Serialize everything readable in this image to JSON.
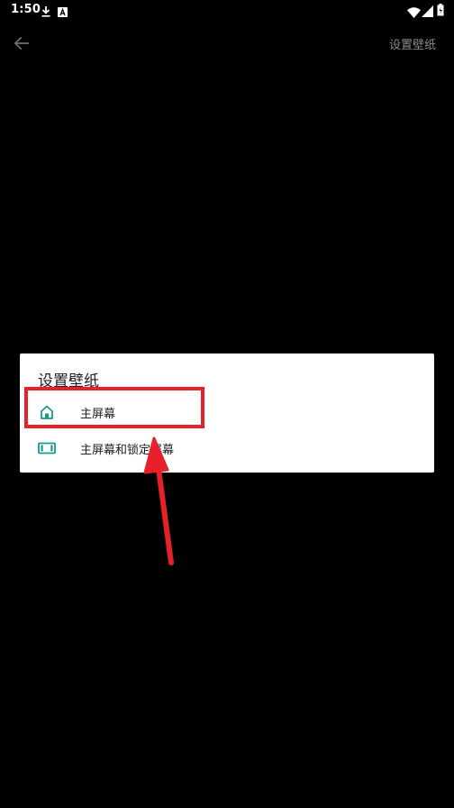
{
  "status_bar": {
    "time": "1:50",
    "icons": [
      "download-icon",
      "a-badge-icon",
      "wifi-icon",
      "signal-icon",
      "battery-icon"
    ]
  },
  "app_bar": {
    "back_icon": "arrow-left-icon",
    "action_label": "设置壁纸"
  },
  "dialog": {
    "title": "设置壁纸",
    "options": [
      {
        "label": "主屏幕",
        "icon": "home-icon"
      },
      {
        "label": "主屏幕和锁定屏幕",
        "icon": "screen-icon"
      }
    ]
  },
  "annotation": {
    "highlight_color": "#e8202a",
    "highlighted_option": "主屏幕"
  },
  "colors": {
    "background": "#000000",
    "dialog_background": "#ffffff",
    "icon_teal": "#1a9a8a",
    "highlight_red": "#e8202a"
  }
}
